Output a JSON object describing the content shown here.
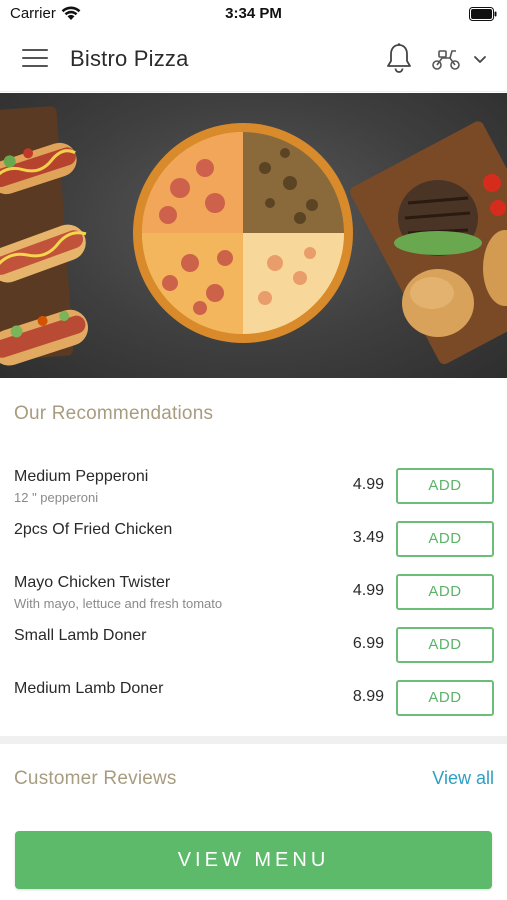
{
  "status_bar": {
    "carrier": "Carrier",
    "time": "3:34 PM"
  },
  "header": {
    "title": "Bistro Pizza",
    "icons": [
      "menu-icon",
      "bell-icon",
      "scooter-icon",
      "chevron-down-icon"
    ]
  },
  "recommendations": {
    "title": "Our Recommendations",
    "add_label": "ADD",
    "items": [
      {
        "name": "Medium Pepperoni",
        "description": "12 \" pepperoni",
        "price": "4.99"
      },
      {
        "name": "2pcs Of Fried Chicken",
        "description": "",
        "price": "3.49"
      },
      {
        "name": "Mayo Chicken Twister",
        "description": "With mayo, lettuce and fresh tomato",
        "price": "4.99"
      },
      {
        "name": "Small Lamb Doner",
        "description": "",
        "price": "6.99"
      },
      {
        "name": "Medium Lamb Doner",
        "description": "",
        "price": "8.99"
      }
    ]
  },
  "reviews": {
    "title": "Customer Reviews",
    "view_all": "View all"
  },
  "footer": {
    "view_menu": "VIEW MENU"
  },
  "colors": {
    "accent_green": "#5cba6a",
    "section_title": "#a89c80",
    "link_blue": "#2f9fc4"
  }
}
